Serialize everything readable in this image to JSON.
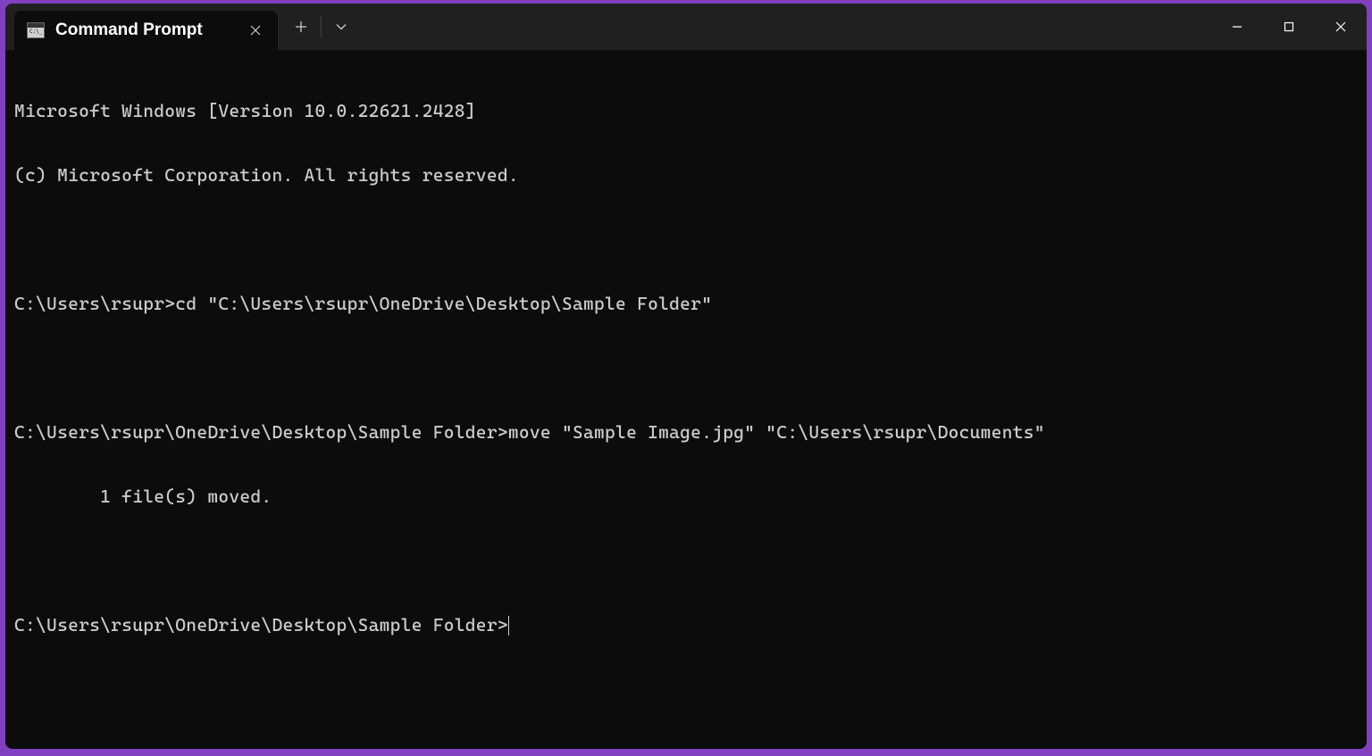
{
  "window": {
    "tab_title": "Command Prompt"
  },
  "terminal": {
    "lines": [
      "Microsoft Windows [Version 10.0.22621.2428]",
      "(c) Microsoft Corporation. All rights reserved.",
      "",
      "C:\\Users\\rsupr>cd \"C:\\Users\\rsupr\\OneDrive\\Desktop\\Sample Folder\"",
      "",
      "C:\\Users\\rsupr\\OneDrive\\Desktop\\Sample Folder>move \"Sample Image.jpg\" \"C:\\Users\\rsupr\\Documents\"",
      "        1 file(s) moved.",
      "",
      "C:\\Users\\rsupr\\OneDrive\\Desktop\\Sample Folder>"
    ]
  }
}
